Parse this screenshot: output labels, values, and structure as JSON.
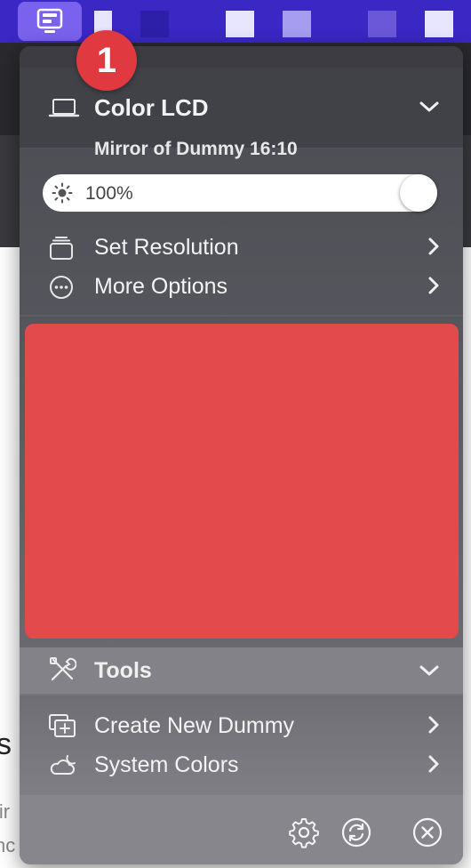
{
  "menubar": {
    "app_icon": "display-manager-icon",
    "accent": "#3a27c4"
  },
  "background_app": {
    "snippets": [
      "s",
      "lir",
      "nc"
    ]
  },
  "display": {
    "icon": "laptop-icon",
    "name": "Color LCD",
    "subtitle": "Mirror of Dummy 16:10",
    "brightness_label": "100%",
    "brightness_level": 1.0
  },
  "menu": {
    "set_resolution": "Set Resolution",
    "more_options": "More Options"
  },
  "preview": {
    "color": "#e34a4b"
  },
  "tools": {
    "title": "Tools",
    "create_new_dummy": "Create New Dummy",
    "system_colors": "System Colors"
  },
  "footer": {
    "icons": [
      "gear-icon",
      "refresh-icon",
      "close-icon"
    ]
  },
  "badge": {
    "label": "1",
    "color": "#e03a40"
  }
}
